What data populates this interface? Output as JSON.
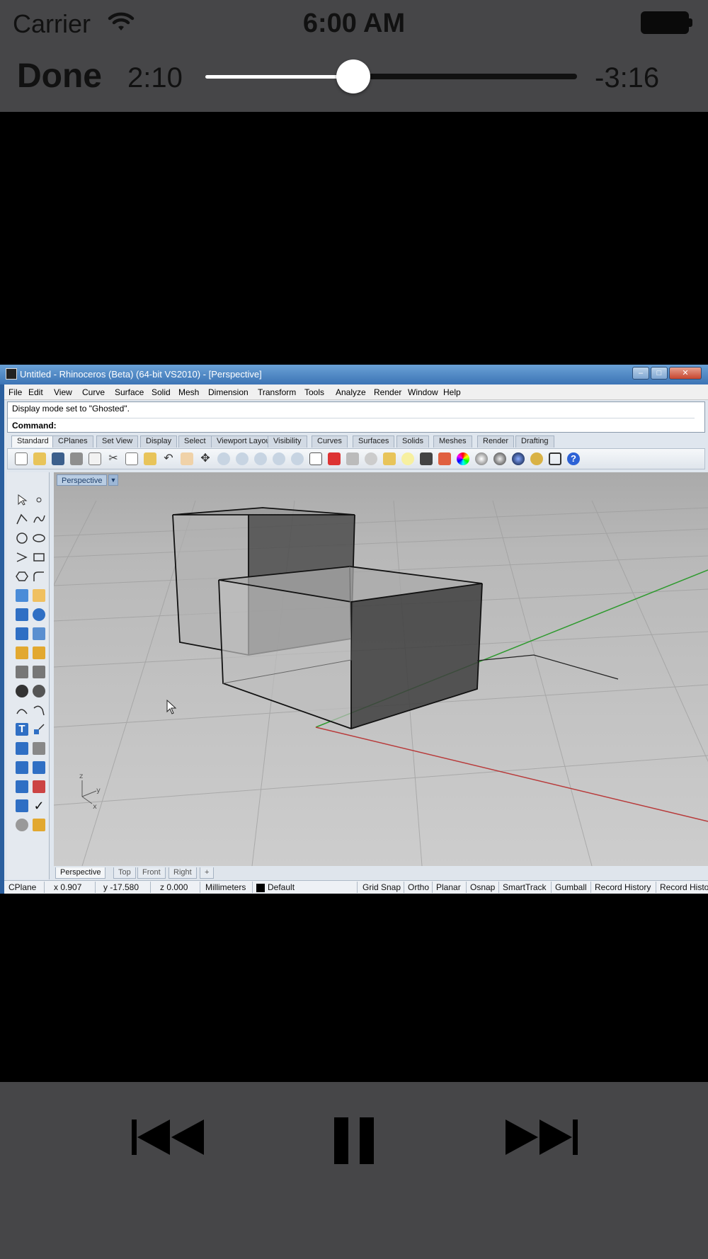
{
  "status_bar": {
    "carrier": "Carrier",
    "time": "6:00 AM"
  },
  "player": {
    "done_label": "Done",
    "elapsed": "2:10",
    "remaining": "-3:16",
    "progress": 0.398,
    "controls": [
      "previous-track",
      "pause",
      "next-track"
    ]
  },
  "rhino": {
    "window_title": "Untitled - Rhinoceros (Beta) (64-bit VS2010) - [Perspective]",
    "menu": [
      "File",
      "Edit",
      "View",
      "Curve",
      "Surface",
      "Solid",
      "Mesh",
      "Dimension",
      "Transform",
      "Tools",
      "Analyze",
      "Render",
      "Window",
      "Help"
    ],
    "history_line": "Display mode set to \"Ghosted\".",
    "command_prompt": "Command:",
    "toolbar_tabs": [
      "Standard",
      "CPlanes",
      "Set View",
      "Display",
      "Select",
      "Viewport Layout",
      "Visibility",
      "Curves",
      "Surfaces",
      "Solids",
      "Meshes",
      "Render",
      "Drafting"
    ],
    "viewport_title": "Perspective",
    "viewport_tabs": [
      "Perspective",
      "Top",
      "Front",
      "Right"
    ],
    "axis_labels": {
      "z": "z",
      "y": "y",
      "x": "x"
    },
    "status": {
      "cplane": "CPlane",
      "x": "x 0.907",
      "y": "y -17.580",
      "z": "z 0.000",
      "units": "Millimeters",
      "layer": "Default",
      "toggles": [
        "Grid Snap",
        "Ortho",
        "Planar",
        "Osnap",
        "SmartTrack",
        "Gumball",
        "Record History",
        "Record Histo"
      ]
    }
  }
}
